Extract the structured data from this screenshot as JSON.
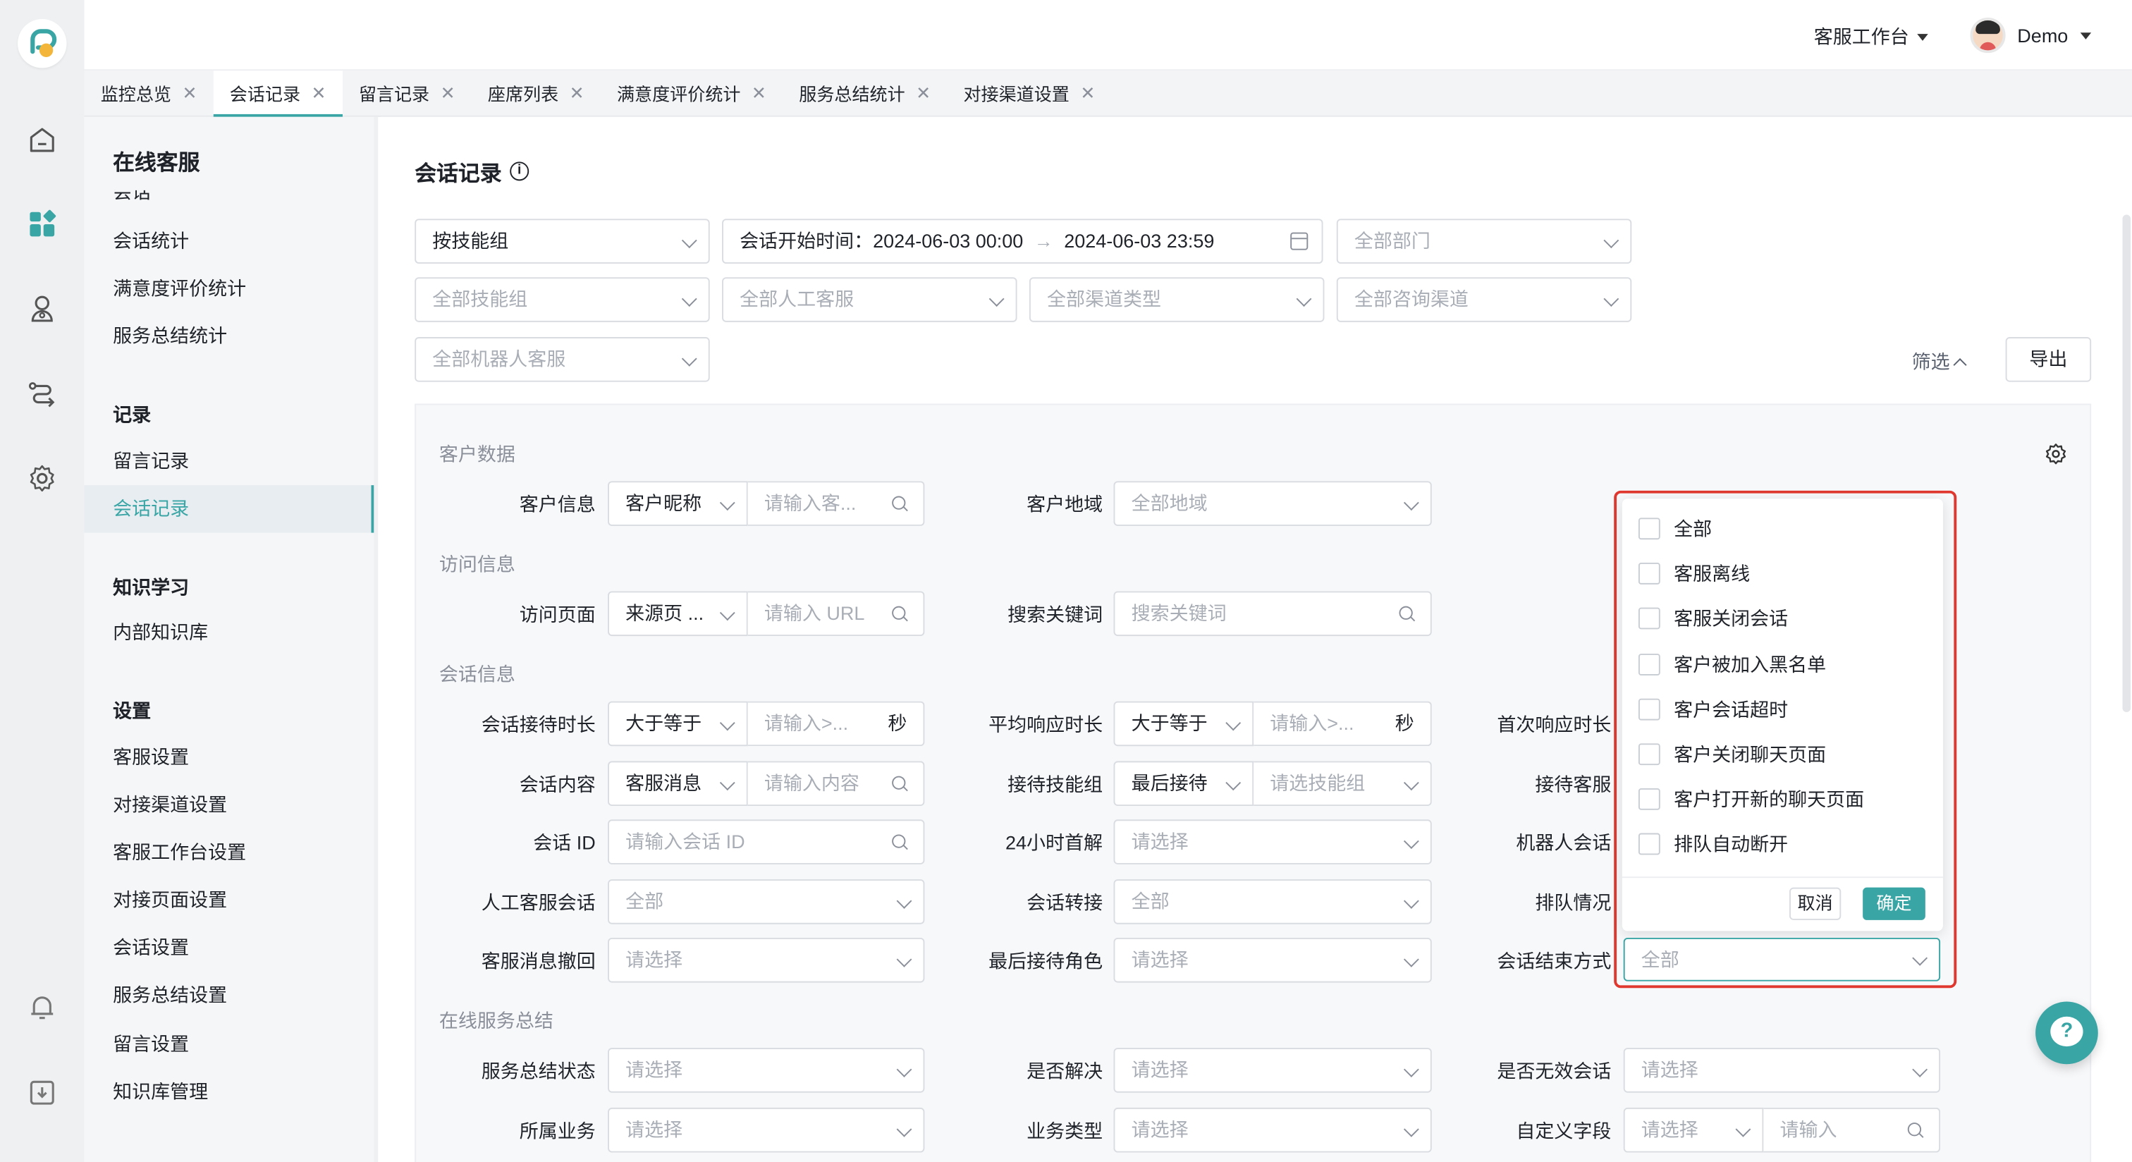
{
  "topbar": {
    "workspace_label": "客服工作台",
    "user_name": "Demo"
  },
  "tabs": [
    {
      "label": "监控总览",
      "close": "✕"
    },
    {
      "label": "会话记录",
      "close": "✕"
    },
    {
      "label": "留言记录",
      "close": "✕"
    },
    {
      "label": "座席列表",
      "close": "✕"
    },
    {
      "label": "满意度评价统计",
      "close": "✕"
    },
    {
      "label": "服务总结统计",
      "close": "✕"
    },
    {
      "label": "对接渠道设置",
      "close": "✕"
    }
  ],
  "sidebar": {
    "title": "在线客服",
    "cut_item": "会话统计",
    "items_a": [
      "会话统计",
      "满意度评价统计",
      "服务总结统计"
    ],
    "group_records": "记录",
    "items_records": [
      "留言记录",
      "会话记录"
    ],
    "group_knowledge": "知识学习",
    "items_knowledge": [
      "内部知识库"
    ],
    "group_settings": "设置",
    "items_settings": [
      "客服设置",
      "对接渠道设置",
      "客服工作台设置",
      "对接页面设置",
      "会话设置",
      "服务总结设置",
      "留言设置",
      "知识库管理"
    ]
  },
  "page": {
    "title": "会话记录",
    "info_icon": "i"
  },
  "filters": {
    "group_by": "按技能组",
    "date_label": "会话开始时间：",
    "date_start": "2024-06-03 00:00",
    "date_arrow": "→",
    "date_end": "2024-06-03 23:59",
    "department": "全部部门",
    "skill_group": "全部技能组",
    "agent": "全部人工客服",
    "channel_type": "全部渠道类型",
    "consult_channel": "全部咨询渠道",
    "robot": "全部机器人客服",
    "filter_toggle": "筛选",
    "export": "导出"
  },
  "panel": {
    "sec_customer": "客户数据",
    "sec_visit": "访问信息",
    "sec_session": "会话信息",
    "sec_summary": "在线服务总结",
    "customer_info_label": "客户信息",
    "customer_info_type": "客户昵称",
    "customer_info_ph": "请输入客...",
    "region_label": "客户地域",
    "region_value": "全部地域",
    "visit_page_label": "访问页面",
    "visit_page_type": "来源页 ...",
    "visit_page_ph": "请输入 URL",
    "keyword_label": "搜索关键词",
    "keyword_ph": "搜索关键词",
    "duration_label": "会话接待时长",
    "duration_op": "大于等于",
    "duration_ph": "请输入>...",
    "unit_sec": "秒",
    "avg_resp_label": "平均响应时长",
    "avg_resp_op": "大于等于",
    "avg_resp_ph": "请输入>...",
    "first_resp_label": "首次响应时长",
    "content_label": "会话内容",
    "content_type": "客服消息",
    "content_ph": "请输入内容",
    "reception_group_label": "接待技能组",
    "reception_group_type": "最后接待",
    "reception_group_ph": "请选技能组",
    "reception_agent_label": "接待客服",
    "session_id_label": "会话 ID",
    "session_id_ph": "请输入会话 ID",
    "first_solve_label": "24小时首解",
    "first_solve_ph": "请选择",
    "robot_session_label": "机器人会话",
    "human_session_label": "人工客服会话",
    "human_session_value": "全部",
    "transfer_label": "会话转接",
    "transfer_value": "全部",
    "queue_label": "排队情况",
    "recall_label": "客服消息撤回",
    "recall_ph": "请选择",
    "last_role_label": "最后接待角色",
    "last_role_ph": "请选择",
    "end_way_label": "会话结束方式",
    "end_way_value": "全部",
    "summary_status_label": "服务总结状态",
    "summary_status_ph": "请选择",
    "resolved_label": "是否解决",
    "resolved_ph": "请选择",
    "invalid_label": "是否无效会话",
    "invalid_ph": "请选择",
    "business_label": "所属业务",
    "business_ph": "请选择",
    "biz_type_label": "业务类型",
    "biz_type_ph": "请选择",
    "custom_label": "自定义字段",
    "custom_sel_ph": "请选择",
    "custom_inp_ph": "请输入"
  },
  "end_dropdown": {
    "options": [
      "全部",
      "客服离线",
      "客服关闭会话",
      "客户被加入黑名单",
      "客户会话超时",
      "客户关闭聊天页面",
      "客户打开新的聊天页面",
      "排队自动断开"
    ],
    "cancel": "取消",
    "confirm": "确定"
  },
  "help_button": {
    "glyph": "?"
  },
  "colors": {
    "accent": "#3aa5a5",
    "highlight": "#e0382f"
  }
}
